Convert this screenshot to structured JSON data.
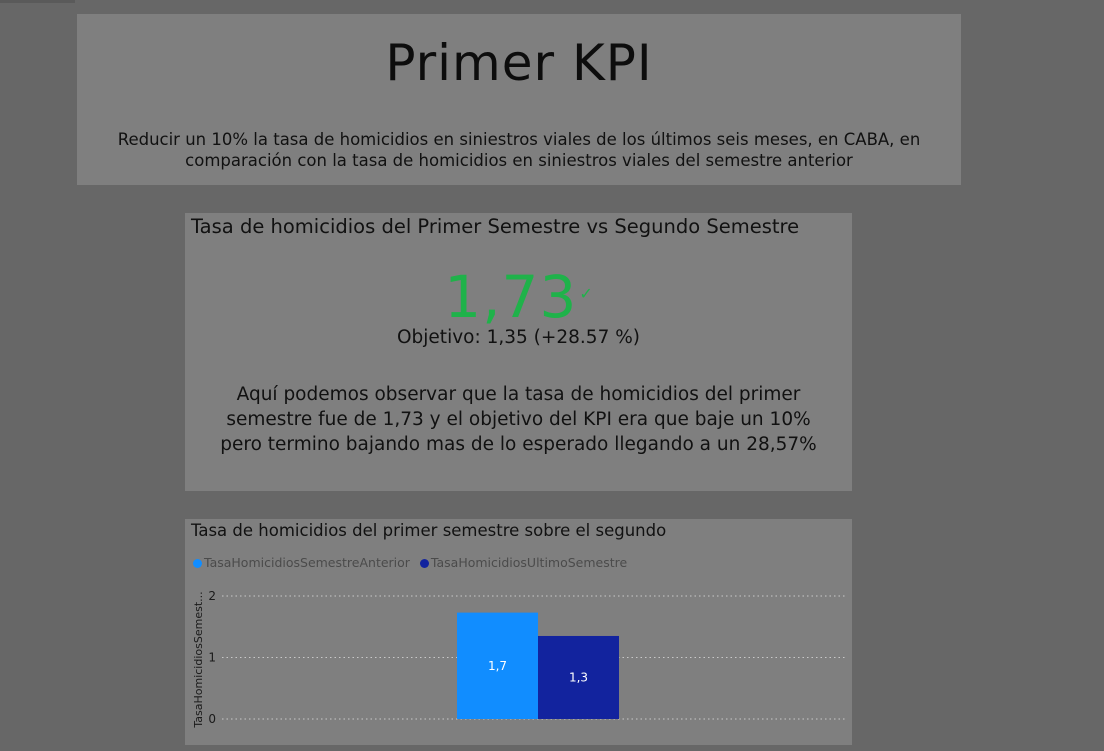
{
  "header": {
    "title": "Primer KPI",
    "subtitle": "Reducir un 10% la tasa de homicidios en siniestros viales de los últimos seis meses, en CABA, en comparación con la tasa de homicidios en siniestros viales del semestre anterior"
  },
  "kpi_card": {
    "title": "Tasa de homicidios del Primer Semestre vs Segundo Semestre",
    "value": "1,73",
    "status_icon": "checkmark-icon",
    "goal_text": "Objetivo: 1,35 (+28.57 %)",
    "note": "Aquí podemos observar que la tasa de homicidios del primer semestre fue de 1,73 y el objetivo del KPI era que baje un 10% pero termino bajando mas de lo esperado llegando a un 28,57%",
    "value_color": "#1fb24a"
  },
  "chart_card": {
    "title": "Tasa de homicidios del primer semestre sobre el segundo"
  },
  "chart_data": {
    "type": "bar",
    "title": "Tasa de homicidios del primer semestre sobre el segundo",
    "xlabel": "",
    "ylabel": "TasaHomicidiosSemest...",
    "ylim": [
      0,
      2
    ],
    "yticks": [
      "0",
      "1",
      "2"
    ],
    "grid": true,
    "legend_position": "top-left",
    "categories": [
      ""
    ],
    "series": [
      {
        "name": "TasaHomicidiosSemestreAnterior",
        "values": [
          1.73
        ],
        "label": "1,7",
        "color": "#118dff"
      },
      {
        "name": "TasaHomicidiosUltimoSemestre",
        "values": [
          1.35
        ],
        "label": "1,3",
        "color": "#12239e"
      }
    ]
  }
}
